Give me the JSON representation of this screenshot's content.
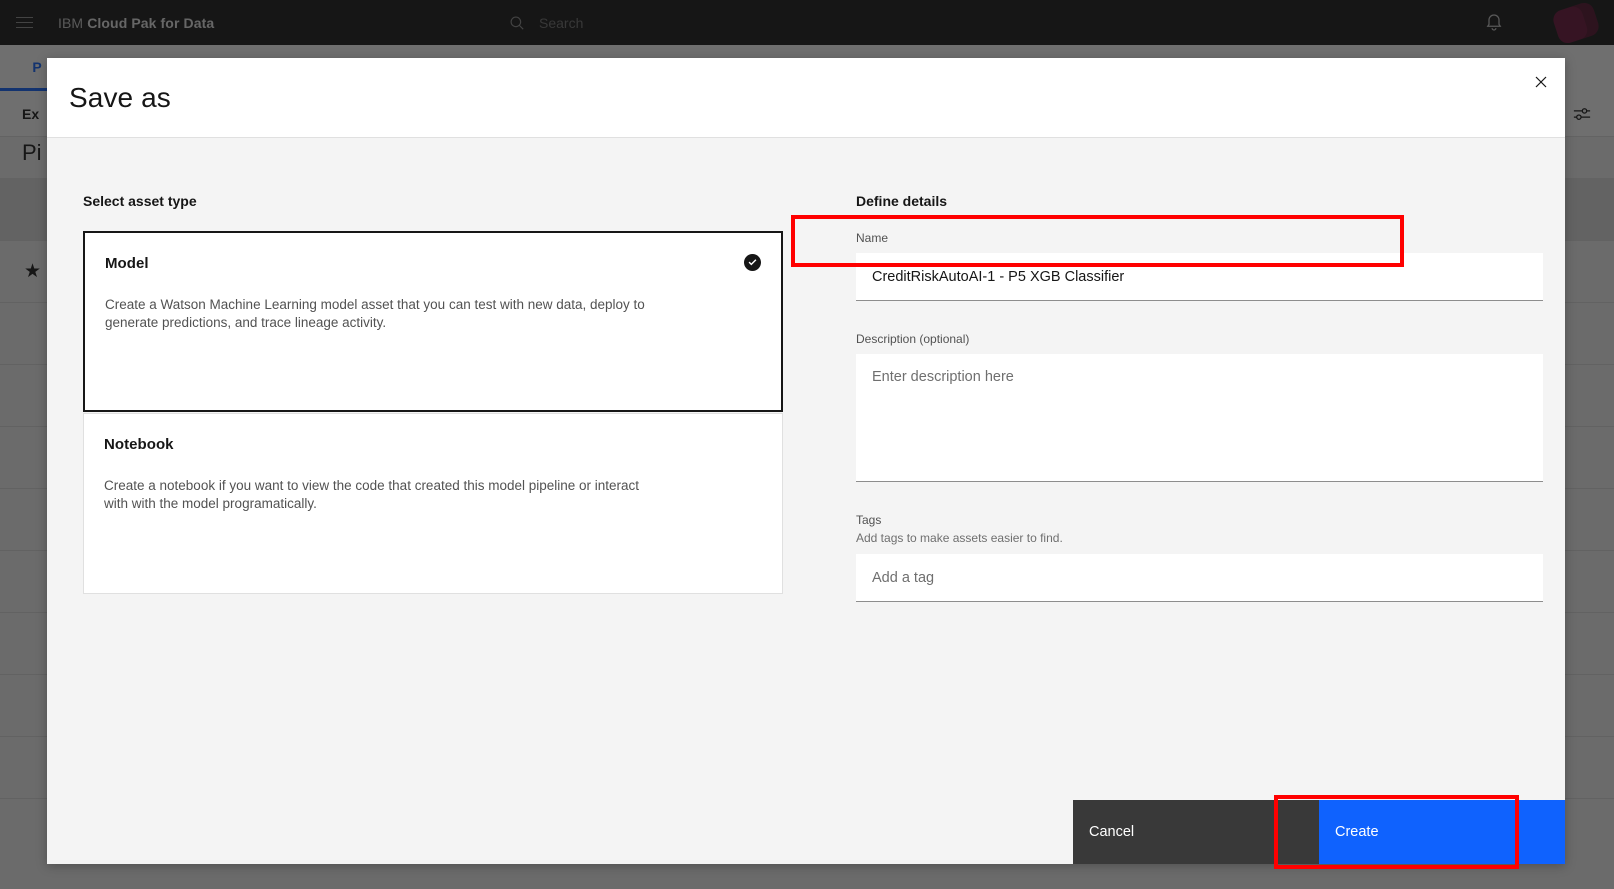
{
  "background": {
    "brand_prefix": "IBM",
    "brand_name": "Cloud Pak for Data",
    "search_placeholder": "Search",
    "tab_label": "P",
    "toolbar_label": "Ex",
    "page_title": "Pi",
    "icons": {
      "menu": "hamburger-menu-icon",
      "search": "search-icon",
      "notifications": "bell-icon",
      "avatar": "user-avatar",
      "grid": "grid-view-icon",
      "filter": "filter-settings-icon",
      "favorite": "star-icon"
    },
    "rows": [
      "",
      "",
      "",
      "",
      "",
      "",
      "",
      "",
      "",
      ""
    ]
  },
  "modal": {
    "title": "Save as",
    "close_label": "Close",
    "asset_section_title": "Select asset type",
    "asset_types": [
      {
        "name": "Model",
        "description": "Create a Watson Machine Learning model asset that you can test with new data, deploy to generate predictions, and trace lineage activity.",
        "selected": true
      },
      {
        "name": "Notebook",
        "description": "Create a notebook if you want to view the code that created this model pipeline or interact with with the model programatically.",
        "selected": false
      }
    ],
    "details_section_title": "Define details",
    "fields": {
      "name": {
        "label": "Name",
        "value": "CreditRiskAutoAI-1 - P5 XGB Classifier",
        "placeholder": ""
      },
      "description": {
        "label": "Description (optional)",
        "value": "",
        "placeholder": "Enter description here"
      },
      "tags": {
        "label": "Tags",
        "helper": "Add tags to make assets easier to find.",
        "value": "",
        "placeholder": "Add a tag"
      }
    },
    "footer": {
      "cancel_label": "Cancel",
      "create_label": "Create"
    }
  },
  "colors": {
    "accent_blue": "#0f62fe",
    "annotation_red": "#ff0000",
    "cancel_gray": "#393939",
    "header_black": "#161616",
    "modal_body": "#f4f4f4"
  }
}
